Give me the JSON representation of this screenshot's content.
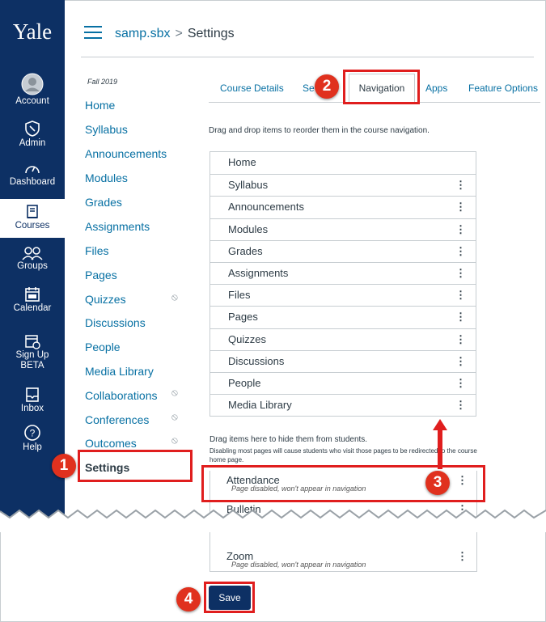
{
  "global_nav": {
    "logo": "Yale",
    "items": [
      {
        "label": "Account",
        "icon": "account-icon"
      },
      {
        "label": "Admin",
        "icon": "shield-icon"
      },
      {
        "label": "Dashboard",
        "icon": "dashboard-icon"
      },
      {
        "label": "Courses",
        "icon": "book-icon"
      },
      {
        "label": "Groups",
        "icon": "groups-icon"
      },
      {
        "label": "Calendar",
        "icon": "calendar-icon"
      },
      {
        "label": "Sign Up",
        "label2": "BETA",
        "icon": "signup-icon"
      },
      {
        "label": "Inbox",
        "icon": "inbox-icon"
      },
      {
        "label": "Help",
        "icon": "help-icon"
      }
    ]
  },
  "header": {
    "course": "samp.sbx",
    "separator": ">",
    "page": "Settings"
  },
  "course_nav": {
    "term": "Fall 2019",
    "items": [
      {
        "label": "Home"
      },
      {
        "label": "Syllabus"
      },
      {
        "label": "Announcements"
      },
      {
        "label": "Modules"
      },
      {
        "label": "Grades"
      },
      {
        "label": "Assignments"
      },
      {
        "label": "Files"
      },
      {
        "label": "Pages"
      },
      {
        "label": "Quizzes"
      },
      {
        "label": "Discussions"
      },
      {
        "label": "People"
      },
      {
        "label": "Media Library"
      },
      {
        "label": "Collaborations"
      },
      {
        "label": "Conferences"
      },
      {
        "label": "Outcomes"
      },
      {
        "label": "Settings"
      }
    ]
  },
  "tabs": [
    "Course Details",
    "Se",
    "Navigation",
    "Apps",
    "Feature Options"
  ],
  "instruction": "Drag and drop items to reorder them in the course navigation.",
  "nav_items": [
    "Home",
    "Syllabus",
    "Announcements",
    "Modules",
    "Grades",
    "Assignments",
    "Files",
    "Pages",
    "Quizzes",
    "Discussions",
    "People",
    "Media Library"
  ],
  "hidden_section": {
    "title": "Drag items here to hide them from students.",
    "subtitle": "Disabling most pages will cause students who visit those pages to be redirected to the course home page.",
    "items": [
      {
        "label": "Attendance",
        "note": "Page disabled, won't appear in navigation"
      },
      {
        "label": "Bulletin"
      },
      {
        "label": "Zoom",
        "note": "Page disabled, won't appear in navigation"
      }
    ]
  },
  "save_label": "Save",
  "callouts": [
    "1",
    "2",
    "3",
    "4"
  ],
  "colors": {
    "nav_bg": "#0d3064",
    "link": "#0770a3",
    "highlight": "#e01e1e"
  }
}
